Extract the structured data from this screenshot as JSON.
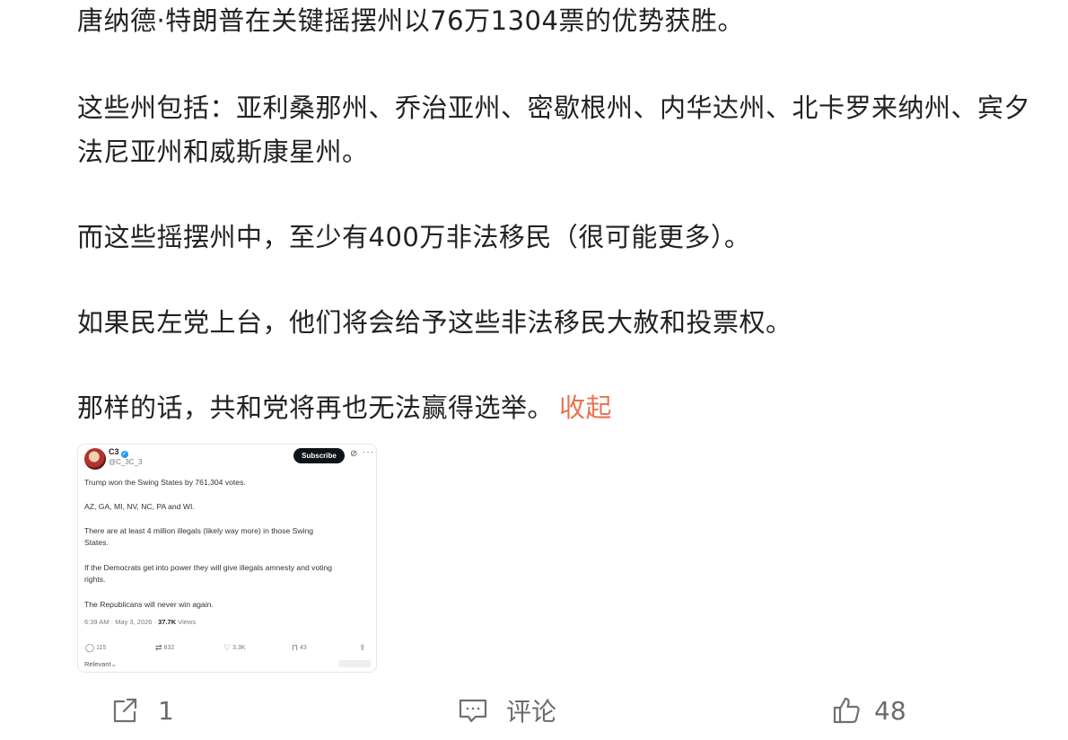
{
  "post": {
    "paragraphs": [
      "唐纳德·特朗普在关键摇摆州以76万1304票的优势获胜。",
      "这些州包括：亚利桑那州、乔治亚州、密歇根州、内华达州、北卡罗来纳州、宾夕法尼亚州和威斯康星州。",
      "而这些摇摆州中，至少有400万非法移民（很可能更多）。",
      "如果民左党上台，他们将会给予这些非法移民大赦和投票权。",
      "那样的话，共和党将再也无法赢得选举。"
    ],
    "collapse_label": "收起",
    "accent_color": "#eb7350"
  },
  "tweet": {
    "name": "C3",
    "handle": "@C_3C_3",
    "subscribe_label": "Subscribe",
    "lines": [
      "Trump won the Swing States by 761,304 votes.",
      "AZ, GA, MI, NV, NC, PA and WI.",
      "There are at least 4 million illegals (likely way more) in those Swing",
      "States.",
      "If the Democrats get into power they will give illegals amnesty and voting",
      "rights.",
      "The Republicans will never win again."
    ],
    "timestamp": "6:39 AM · May 3, 2026 · ",
    "views_count": "37.7K",
    "views_label": " Views",
    "replies": "115",
    "reposts": "832",
    "likes": "3.3K",
    "bookmarks": "43",
    "relevant_label": "Relevant",
    "icons": [
      "avatar",
      "verified-icon",
      "grok-icon",
      "more-icon",
      "reply-icon",
      "repost-icon",
      "heart-icon",
      "bookmark-icon",
      "share-icon",
      "chevron-down-icon"
    ]
  },
  "actions": {
    "share_count": "1",
    "comment_label": "评论",
    "like_count": "48",
    "icons": [
      "share-icon",
      "comment-icon",
      "thumbs-up-icon"
    ]
  }
}
